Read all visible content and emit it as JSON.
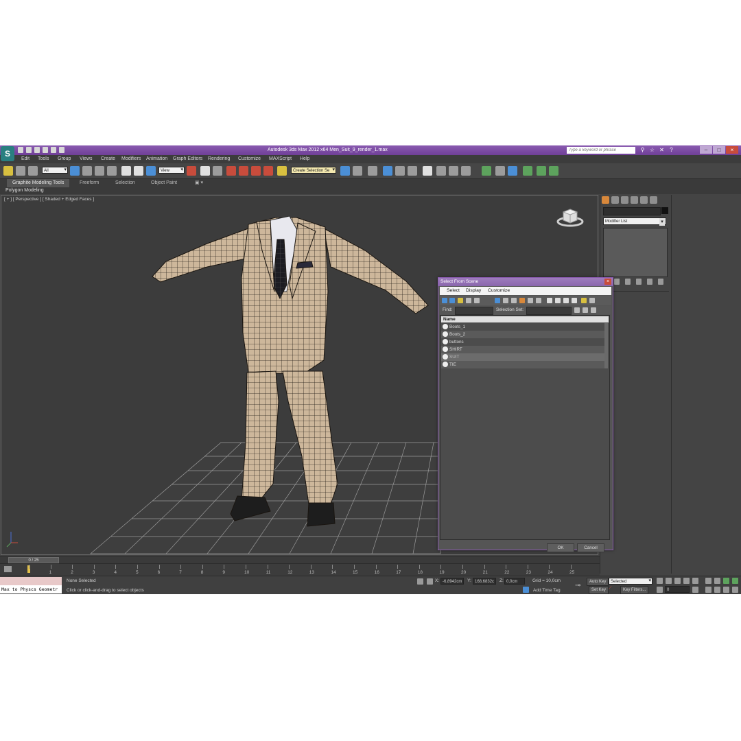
{
  "app": {
    "title": "Autodesk 3ds Max  2012 x64     Men_Suit_9_render_1.max",
    "search_placeholder": "Type a keyword or phrase",
    "accent_color": "#7a4aa6",
    "menu": [
      "Edit",
      "Tools",
      "Group",
      "Views",
      "Create",
      "Modifiers",
      "Animation",
      "Graph Editors",
      "Rendering",
      "Customize",
      "MAXScript",
      "Help"
    ]
  },
  "toolbar": {
    "selection_filter": "All",
    "reference_coord": "View",
    "named_selection": "Create Selection Se"
  },
  "ribbon": {
    "tabs": [
      "Graphite Modeling Tools",
      "Freeform",
      "Selection",
      "Object Paint"
    ],
    "sub_label": "Polygon Modeling"
  },
  "viewport": {
    "label": "[ + ] [ Perspective ] [ Shaded + Edged Faces ]",
    "viewcube_label": "FRONT"
  },
  "command_panel": {
    "modifier_list": "Modifier List"
  },
  "dialog": {
    "title": "Select From Scene",
    "menu": [
      "Select",
      "Display",
      "Customize"
    ],
    "find_label": "Find:",
    "selection_set_label": "Selection Set:",
    "column_name": "Name",
    "objects": [
      "Boots_1",
      "Boots_2",
      "buttons",
      "SHIRT",
      "SUIT",
      "TIE"
    ],
    "selected_object": "SUIT",
    "ok_label": "OK",
    "cancel_label": "Cancel"
  },
  "timeline": {
    "frame_display": "0 / 25",
    "ticks": [
      "0",
      "1",
      "2",
      "3",
      "4",
      "5",
      "6",
      "7",
      "8",
      "9",
      "10",
      "11",
      "12",
      "13",
      "14",
      "15",
      "16",
      "17",
      "18",
      "19",
      "20",
      "21",
      "22",
      "23",
      "24",
      "25"
    ]
  },
  "status": {
    "maxscript_line": "Max to Physcs Geometr",
    "selection_status": "None Selected",
    "prompt": "Click or click-and-drag to select objects",
    "x_label": "X:",
    "x_value": "-6,8942cm",
    "y_label": "Y:",
    "y_value": "168,6832c",
    "z_label": "Z:",
    "z_value": "0,0cm",
    "grid": "Grid = 10,0cm",
    "add_time_tag": "Add Time Tag",
    "auto_key": "Auto Key",
    "set_key": "Set Key",
    "key_mode": "Selected",
    "key_filters": "Key Filters...",
    "frame_field": "0"
  }
}
